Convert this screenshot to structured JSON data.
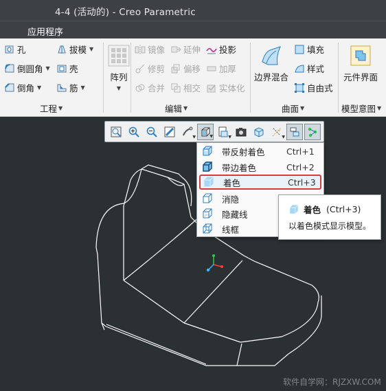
{
  "window": {
    "title": "4-4 (活动的) - Creo Parametric"
  },
  "menubar": {
    "app_menu": "应用程序"
  },
  "ribbon": {
    "engineering": {
      "hole": "孔",
      "draft": "拔模",
      "round": "倒圆角",
      "shell": "壳",
      "chamfer": "倒角",
      "rib": "筋",
      "group_label": "工程"
    },
    "pattern": {
      "label": "阵列"
    },
    "editing": {
      "mirror": "镜像",
      "extend": "延伸",
      "project": "投影",
      "trim": "修剪",
      "offset": "偏移",
      "thicken": "加厚",
      "merge": "合并",
      "intersect": "相交",
      "solidify": "实体化",
      "group_label": "编辑"
    },
    "surfaces": {
      "boundary_blend": "边界混合",
      "fill": "填充",
      "style": "样式",
      "freestyle": "自由式",
      "group_label": "曲面"
    },
    "model_intent": {
      "component_interface": "元件界面",
      "group_label": "模型意图"
    }
  },
  "view_toolbar": {
    "buttons": [
      "refit-icon",
      "zoom-in-icon",
      "zoom-out-icon",
      "repaint-icon",
      "spin-center-icon",
      "display-style-icon",
      "saved-views-icon",
      "camera-icon",
      "perspective-icon",
      "datum-display-icon",
      "annotation-display-icon",
      "spin-axis-icon"
    ]
  },
  "display_menu": {
    "items": [
      {
        "label": "带反射着色",
        "shortcut": "Ctrl+1"
      },
      {
        "label": "带边着色",
        "shortcut": "Ctrl+2"
      },
      {
        "label": "着色",
        "shortcut": "Ctrl+3"
      },
      {
        "label": "消隐",
        "shortcut": ""
      },
      {
        "label": "隐藏线",
        "shortcut": ""
      },
      {
        "label": "线框",
        "shortcut": ""
      }
    ],
    "selected_index": 2
  },
  "tooltip": {
    "title": "着色",
    "shortcut": "(Ctrl+3)",
    "description": "以着色模式显示模型。"
  },
  "watermark": "软件自学网：RJZXW.COM",
  "colors": {
    "background": "#2b3032",
    "ribbon": "#f3f3f3",
    "selection_border": "#d83b3b",
    "icon_blue": "#2e7dbf"
  }
}
